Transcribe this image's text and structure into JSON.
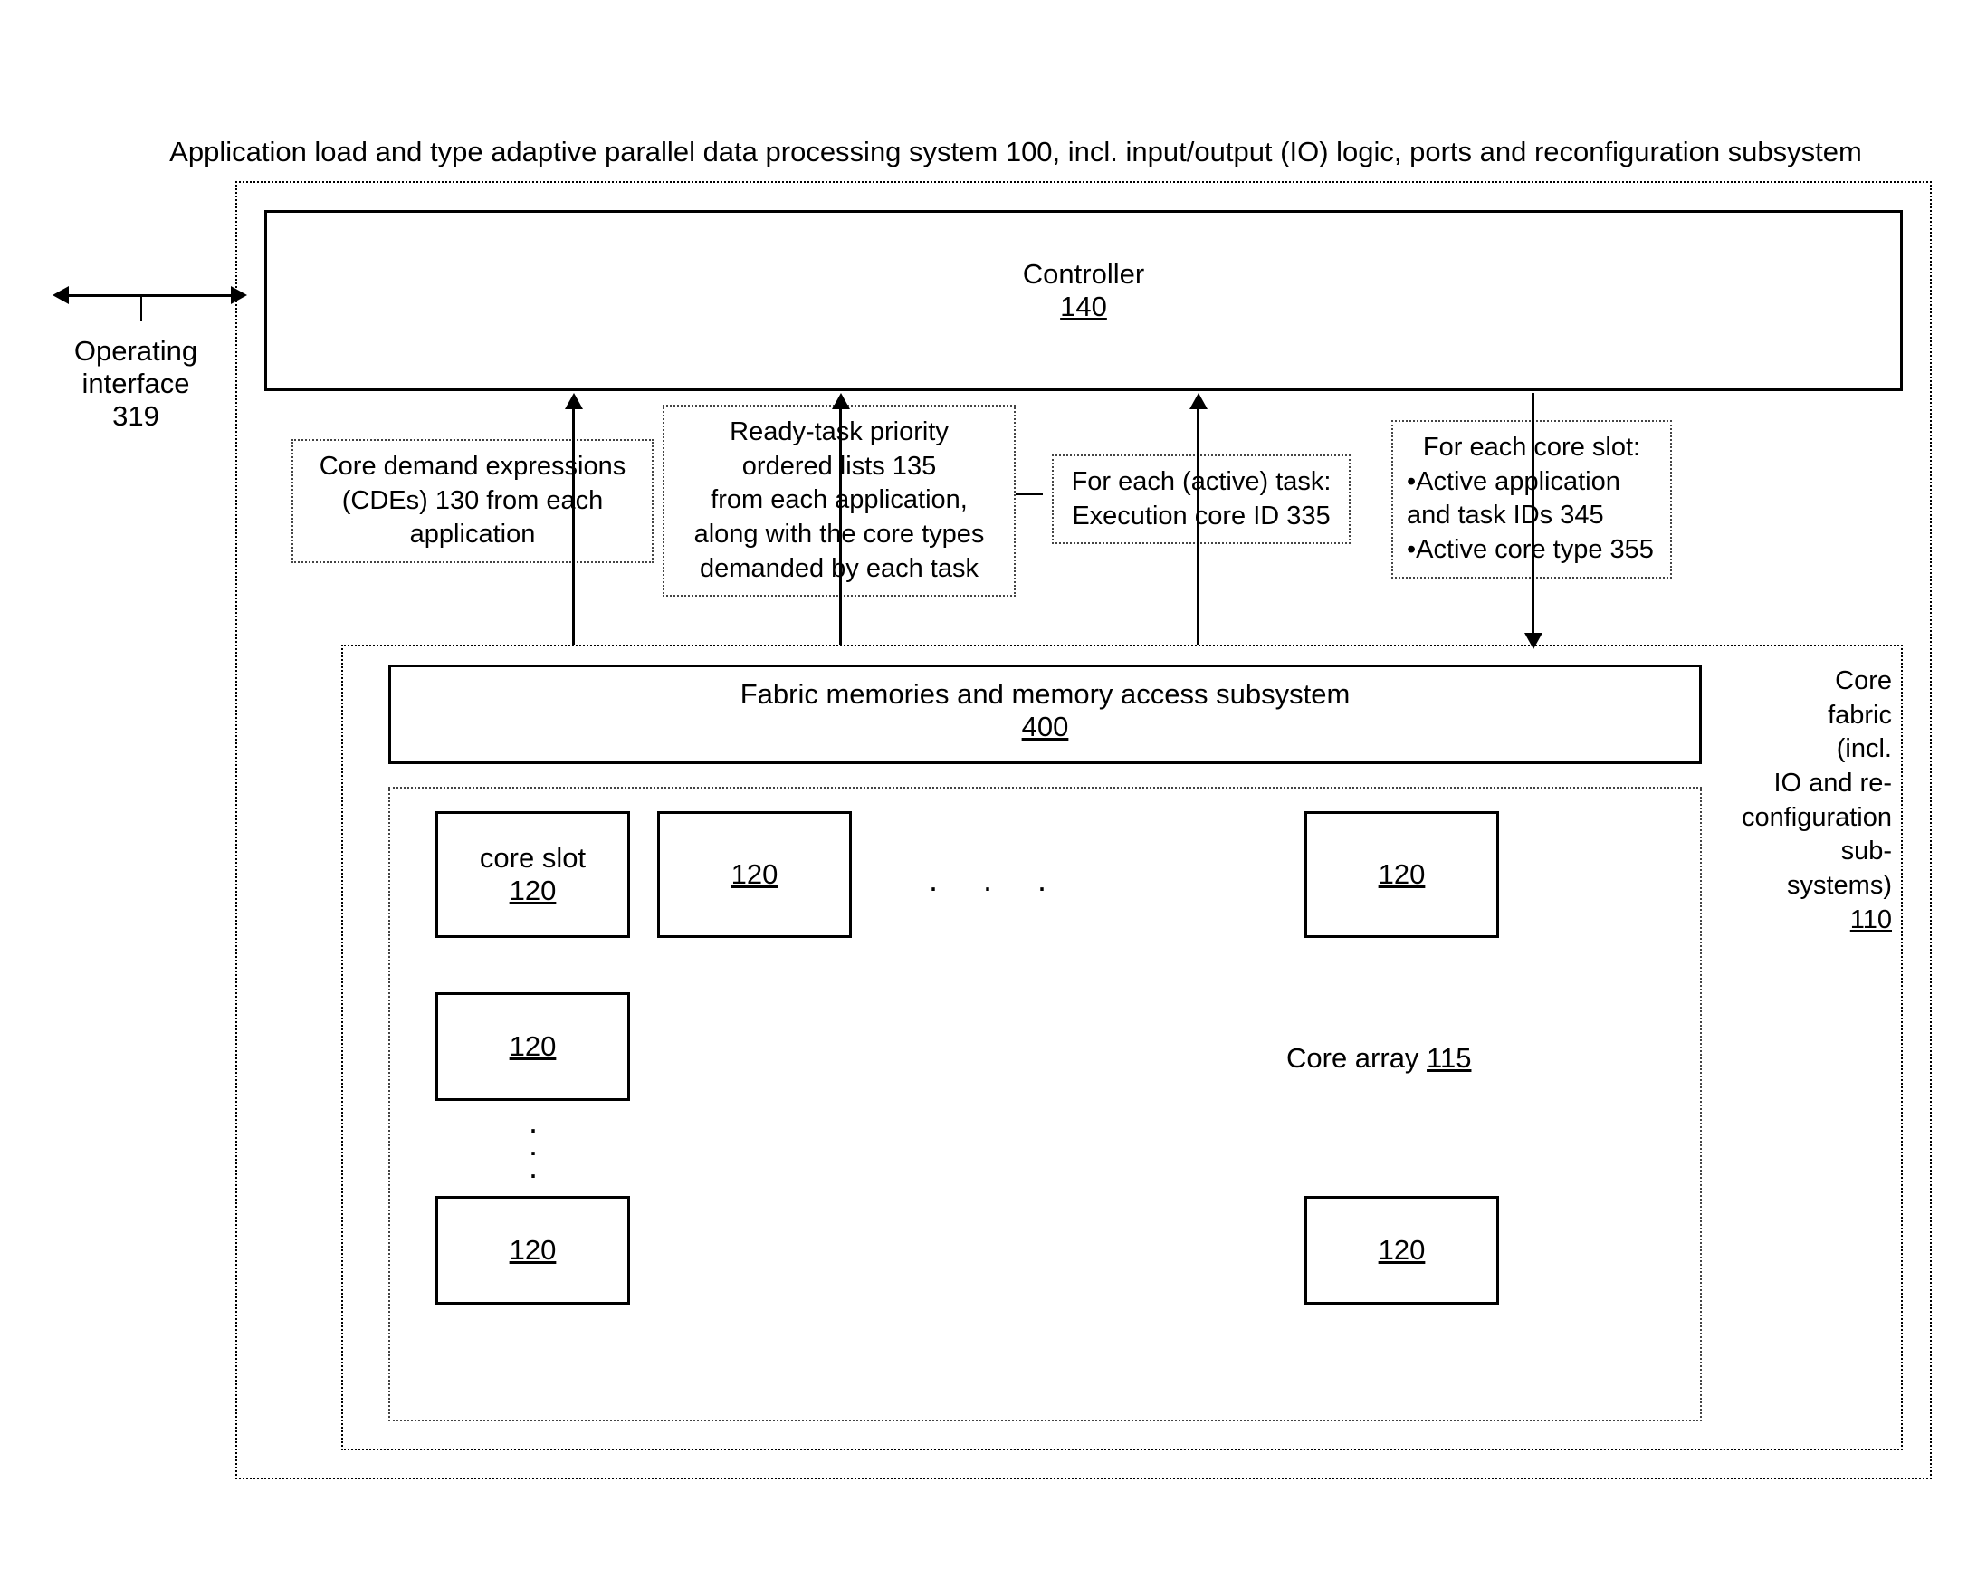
{
  "title": "Application load and type adaptive parallel data processing system 100, incl. input/output (IO) logic, ports and reconfiguration subsystem",
  "operating_interface": {
    "line1": "Operating",
    "line2": "interface",
    "line3": "319"
  },
  "controller": {
    "label": "Controller",
    "ref": "140"
  },
  "signals": {
    "cde": {
      "line1": "Core demand expressions",
      "line2": "(CDEs) 130 from each",
      "line3": "application"
    },
    "ready_task": {
      "line1": "Ready-task priority",
      "line2": "ordered lists 135",
      "line3": "from each application,",
      "line4": "along with the core types",
      "line5": "demanded by each task"
    },
    "execution_core": {
      "line1": "For each (active) task:",
      "line2": "Execution core ID 335"
    },
    "core_slot_info": {
      "line1": "For each core slot:",
      "line2": "•Active application",
      "line3": "and task IDs 345",
      "line4": "•Active core type 355"
    }
  },
  "fabric_memories": {
    "label": "Fabric memories and memory access subsystem",
    "ref": "400"
  },
  "fabric_label": {
    "line1": "Core",
    "line2": "fabric",
    "line3": "(incl.",
    "line4": "IO and re-",
    "line5": "configuration",
    "line6": "sub-",
    "line7": "systems)",
    "ref": "110"
  },
  "core_array": {
    "label_text": "Core array ",
    "ref": "115"
  },
  "core_slot": {
    "label": "core slot",
    "ref": "120"
  }
}
